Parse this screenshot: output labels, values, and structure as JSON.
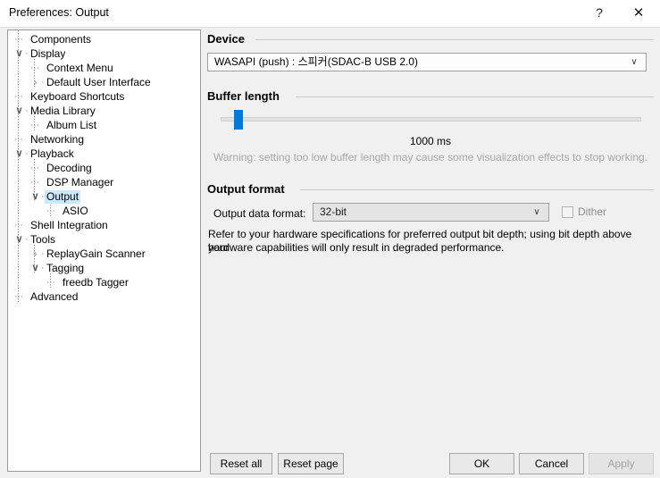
{
  "window": {
    "title": "Preferences: Output",
    "help_icon": "question-mark-icon",
    "close_icon": "close-icon"
  },
  "tree": {
    "items": [
      {
        "label": "Components",
        "indent": 0,
        "chevron": "none",
        "selected": false
      },
      {
        "label": "Display",
        "indent": 0,
        "chevron": "expanded",
        "selected": false
      },
      {
        "label": "Context Menu",
        "indent": 1,
        "chevron": "none",
        "selected": false
      },
      {
        "label": "Default User Interface",
        "indent": 1,
        "chevron": "collapsed",
        "selected": false
      },
      {
        "label": "Keyboard Shortcuts",
        "indent": 0,
        "chevron": "none",
        "selected": false
      },
      {
        "label": "Media Library",
        "indent": 0,
        "chevron": "expanded",
        "selected": false
      },
      {
        "label": "Album List",
        "indent": 1,
        "chevron": "none",
        "selected": false
      },
      {
        "label": "Networking",
        "indent": 0,
        "chevron": "none",
        "selected": false
      },
      {
        "label": "Playback",
        "indent": 0,
        "chevron": "expanded",
        "selected": false
      },
      {
        "label": "Decoding",
        "indent": 1,
        "chevron": "none",
        "selected": false
      },
      {
        "label": "DSP Manager",
        "indent": 1,
        "chevron": "none",
        "selected": false
      },
      {
        "label": "Output",
        "indent": 1,
        "chevron": "expanded",
        "selected": true
      },
      {
        "label": "ASIO",
        "indent": 2,
        "chevron": "none",
        "selected": false
      },
      {
        "label": "Shell Integration",
        "indent": 0,
        "chevron": "none",
        "selected": false
      },
      {
        "label": "Tools",
        "indent": 0,
        "chevron": "expanded",
        "selected": false
      },
      {
        "label": "ReplayGain Scanner",
        "indent": 1,
        "chevron": "collapsed",
        "selected": false
      },
      {
        "label": "Tagging",
        "indent": 1,
        "chevron": "expanded",
        "selected": false
      },
      {
        "label": "freedb Tagger",
        "indent": 2,
        "chevron": "none",
        "selected": false
      },
      {
        "label": "Advanced",
        "indent": 0,
        "chevron": "none",
        "selected": false
      }
    ]
  },
  "device_section": {
    "header": "Device",
    "selected_device": "WASAPI (push) : 스피커(SDAC-B USB 2.0)"
  },
  "buffer_section": {
    "header": "Buffer length",
    "value": "1000 ms",
    "warning": "Warning: setting too low buffer length may cause some visualization effects to stop working."
  },
  "output_format_section": {
    "header": "Output format",
    "data_format_label": "Output data format:",
    "data_format_value": "32-bit",
    "dither_label": "Dither",
    "hint_line1": "Refer to your hardware specifications for preferred output bit depth; using bit depth above your",
    "hint_line2": "hardware capabilities will only result in degraded performance."
  },
  "buttons": {
    "reset_all": "Reset all",
    "reset_page": "Reset page",
    "ok": "OK",
    "cancel": "Cancel",
    "apply": "Apply"
  },
  "colors": {
    "accent": "#0078d7",
    "selection": "#cce8ff",
    "window_bg": "#f0f0f0",
    "disabled_text": "#a2a2a2"
  }
}
